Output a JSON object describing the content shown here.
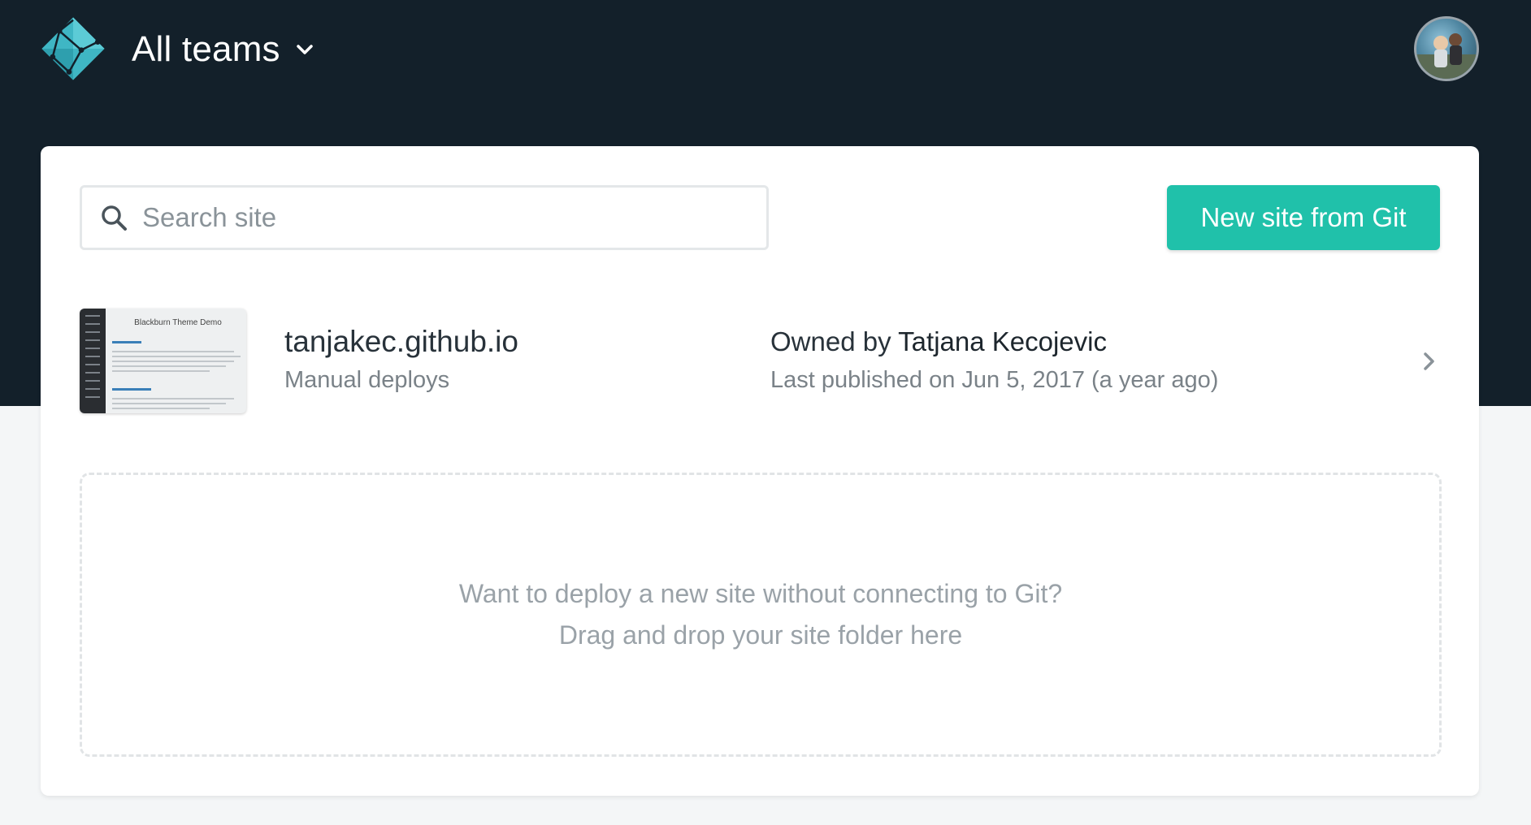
{
  "header": {
    "team_label": "All teams",
    "logo_icon": "netlify-logo-icon",
    "avatar_icon": "user-avatar"
  },
  "toolbar": {
    "search_placeholder": "Search site",
    "new_site_label": "New site from Git",
    "accent_color": "#20c1aa"
  },
  "sites": [
    {
      "thumbnail_title": "Blackburn Theme Demo",
      "name": "tanjakec.github.io",
      "deploy_type": "Manual deploys",
      "owned_by_prefix": "Owned by",
      "owner": "Tatjana Kecojevic",
      "last_published": "Last published on Jun 5, 2017 (a year ago)"
    }
  ],
  "dropzone": {
    "line1": "Want to deploy a new site without connecting to Git?",
    "line2": "Drag and drop your site folder here"
  },
  "colors": {
    "header_bg": "#13202a",
    "page_bg": "#f4f6f7",
    "card_bg": "#ffffff"
  }
}
